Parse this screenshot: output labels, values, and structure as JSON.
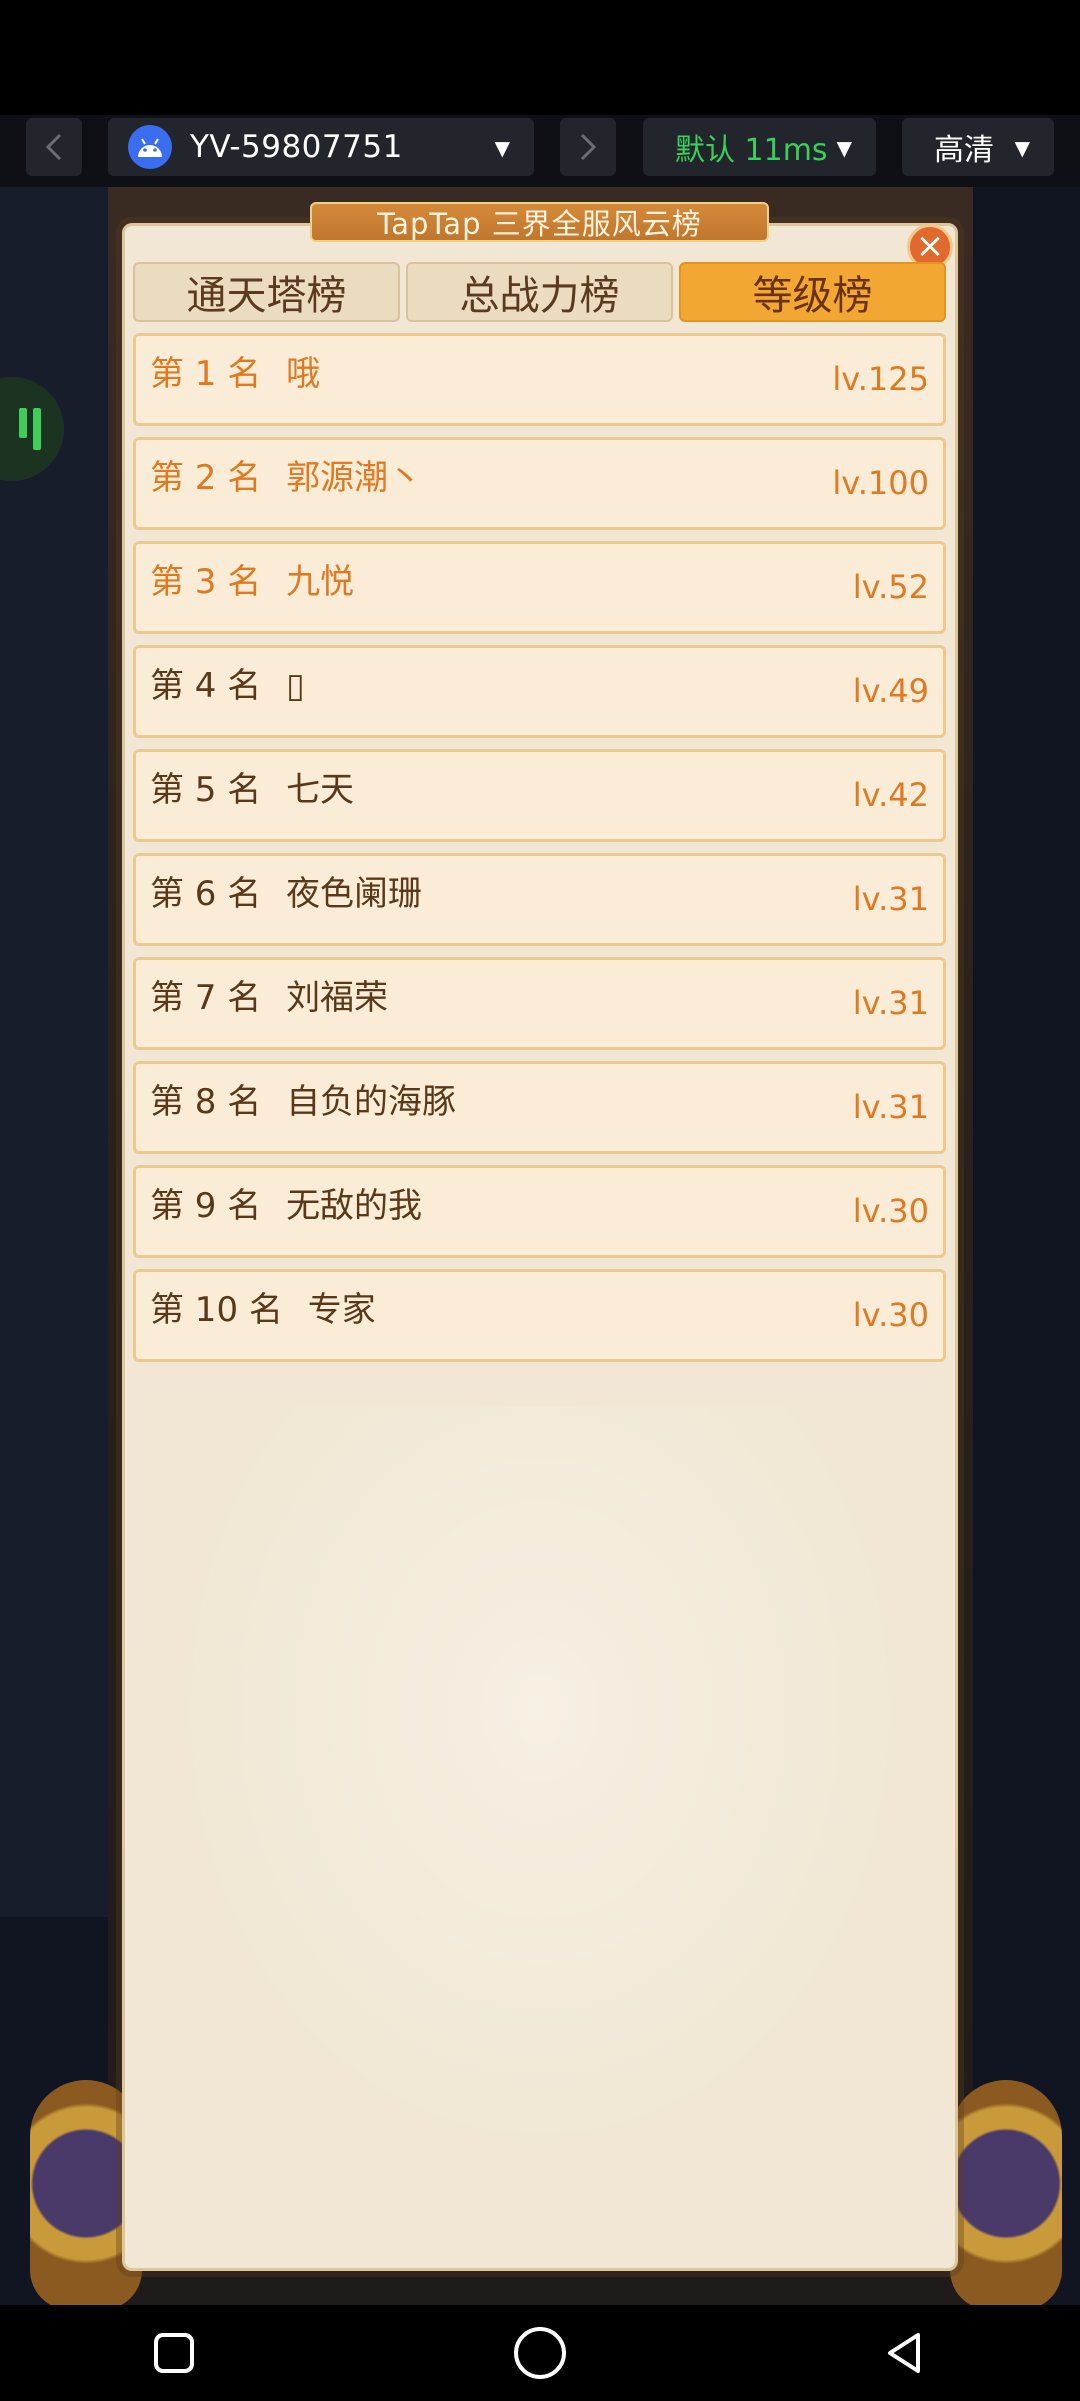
{
  "toolbar": {
    "prev_icon": "chevron-left",
    "next_icon": "chevron-right",
    "device_label": "YV-59807751",
    "latency_label": "默认 11ms",
    "quality_label": "高清",
    "latency_color": "#37d058"
  },
  "game": {
    "board_title": "TapTap 三界全服风云榜",
    "tabs": [
      {
        "label": "通天塔榜",
        "active": false
      },
      {
        "label": "总战力榜",
        "active": false
      },
      {
        "label": "等级榜",
        "active": true
      }
    ],
    "rankings": [
      {
        "rank": "第 1 名",
        "name": "哦",
        "level": "lv.125",
        "highlight": true
      },
      {
        "rank": "第 2 名",
        "name": "郭源潮丶",
        "level": "lv.100",
        "highlight": true
      },
      {
        "rank": "第 3 名",
        "name": "九悦",
        "level": "lv.52",
        "highlight": true
      },
      {
        "rank": "第 4 名",
        "name": "▯",
        "level": "lv.49",
        "highlight": false
      },
      {
        "rank": "第 5 名",
        "name": "七天",
        "level": "lv.42",
        "highlight": false
      },
      {
        "rank": "第 6 名",
        "name": "夜色阑珊",
        "level": "lv.31",
        "highlight": false
      },
      {
        "rank": "第 7 名",
        "name": "刘福荣",
        "level": "lv.31",
        "highlight": false
      },
      {
        "rank": "第 8 名",
        "name": "自负的海豚",
        "level": "lv.31",
        "highlight": false
      },
      {
        "rank": "第 9 名",
        "name": "无敌的我",
        "level": "lv.30",
        "highlight": false
      },
      {
        "rank": "第 10 名",
        "name": "专家",
        "level": "lv.30",
        "highlight": false
      }
    ],
    "colors": {
      "accent": "#f1a732",
      "top_rank": "#e07a22",
      "rank": "#5a391b"
    }
  },
  "android_nav": {
    "icons": [
      "recent-apps",
      "home",
      "back"
    ]
  }
}
